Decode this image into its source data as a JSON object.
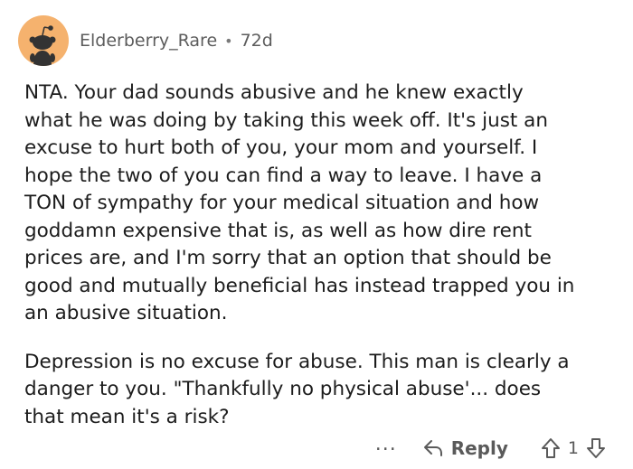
{
  "comment": {
    "username": "Elderberry_Rare",
    "separator": "•",
    "age": "72d",
    "paragraphs": [
      "NTA. Your dad sounds abusive and he knew exactly\nwhat he was doing by taking this week off. It's just an\nexcuse to hurt both of you, your mom and yourself. I\nhope the two of you can find a way to leave. I have a\nTON of sympathy for your medical situation and how\ngoddamn expensive that is, as well as how dire rent\nprices are, and I'm sorry that an option that should be\ngood and mutually beneficial has instead trapped you in\nan abusive situation.",
      "Depression is no excuse for abuse. This man is clearly a\ndanger to you. \"Thankfully no physical abuse'... does\nthat mean it's a risk?"
    ]
  },
  "actions": {
    "more_label": "...",
    "reply_label": "Reply",
    "score": "1"
  },
  "icons": {
    "avatar": "reddit-snoo-avatar",
    "reply": "reply-arrow-icon",
    "upvote": "upvote-arrow-icon",
    "downvote": "downvote-arrow-icon"
  },
  "colors": {
    "avatar_background": "#f5b26e",
    "muted_text": "#5c5c5c",
    "body_text": "#1c1c1c"
  }
}
